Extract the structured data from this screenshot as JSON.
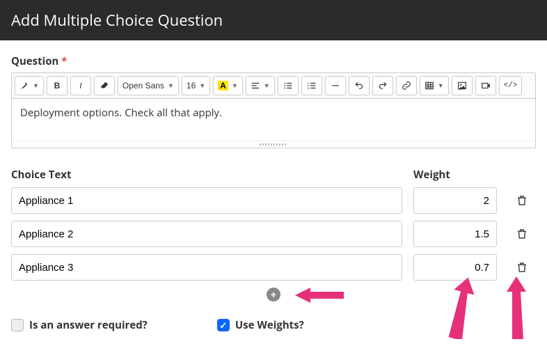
{
  "header": {
    "title": "Add Multiple Choice Question"
  },
  "question": {
    "label": "Question",
    "required_marker": "*",
    "text": "Deployment options.  Check all that apply."
  },
  "toolbar": {
    "font_family": "Open Sans",
    "font_size": "16"
  },
  "choices": {
    "choice_label": "Choice Text",
    "weight_label": "Weight",
    "rows": [
      {
        "text": "Appliance 1",
        "weight": "2"
      },
      {
        "text": "Appliance 2",
        "weight": "1.5"
      },
      {
        "text": "Appliance 3",
        "weight": "0.7"
      }
    ]
  },
  "options": {
    "required_label": "Is an answer required?",
    "required_checked": false,
    "use_weights_label": "Use Weights?",
    "use_weights_checked": true
  }
}
